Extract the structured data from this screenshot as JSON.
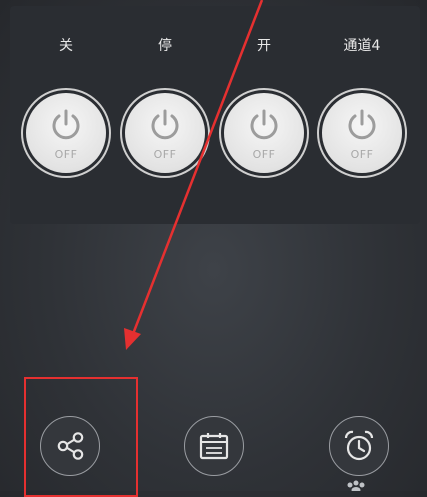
{
  "channels": [
    {
      "label": "关",
      "state": "OFF"
    },
    {
      "label": "停",
      "state": "OFF"
    },
    {
      "label": "开",
      "state": "OFF"
    },
    {
      "label": "通道4",
      "state": "OFF"
    }
  ],
  "bottom_actions": [
    {
      "icon": "share-icon"
    },
    {
      "icon": "calendar-icon"
    },
    {
      "icon": "alarm-clock-icon"
    }
  ],
  "colors": {
    "annotation": "#e53030",
    "background": "#2f3237",
    "switch_face": "#e8e8e8"
  }
}
